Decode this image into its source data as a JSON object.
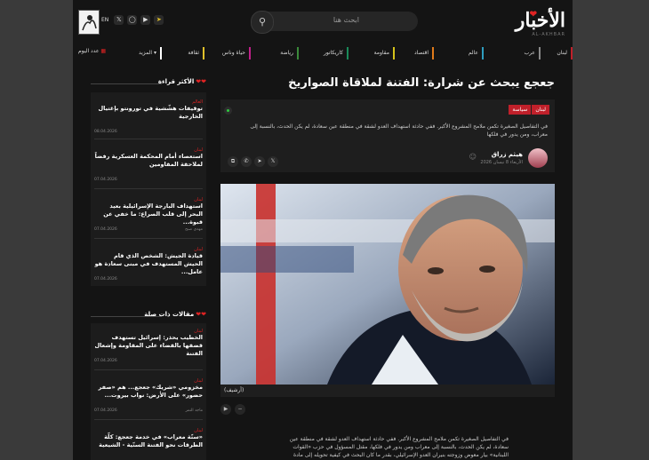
{
  "header": {
    "logo_text": "الأخبار",
    "logo_sub": "AL-AKHBAR",
    "search_placeholder": "ابحث هنا",
    "search_icon": "search-icon",
    "lang": "EN",
    "socials": [
      "x-icon",
      "youtube-icon",
      "instagram-icon",
      "telegram-icon"
    ]
  },
  "nav": {
    "items": [
      "لبنان",
      "عرب",
      "عالم",
      "اقتصاد",
      "مقاومة",
      "كاريكاتور",
      "رياضة",
      "حياة وناس",
      "ثقافة",
      "المزيد"
    ],
    "more_label": "المزيد",
    "today_label": "عدد اليوم",
    "colors": [
      "#c0202a",
      "#8a8a8a",
      "#2e9dbf",
      "#e07a1a",
      "#d4c21a",
      "#1a8a5a",
      "#3a8a3a",
      "#c0208a",
      "#e0c02a",
      "#ffffff"
    ]
  },
  "article": {
    "title": "جعجع يبحث عن شرارة: الفتنة لملاقاة الصواريخ",
    "tags": [
      "لبنان",
      "سياسة"
    ],
    "lead": "في التفاصيل الصغيرة تكمن ملامح المشروع الأكبر. ففي حادثة استهداف العدو لشقة في منطقة عين سعادة، لم يكن الحدث، بالنسبة إلى معراب، ومن يدور في فلكها",
    "author": "هيثم زراق",
    "date": "الأربعاء 8 نيسان 2026",
    "share_icons": [
      "x-icon",
      "telegram-icon",
      "whatsapp-icon",
      "copy-icon"
    ],
    "image_caption": "(أرشيف)",
    "body": "في التفاصيل الصغيرة تكمن ملامح المشروع الأكبر. ففي حادثة استهداف العدو لشقة في منطقة عين سعادة، لم يكن الحدث، بالنسبة إلى معراب ومن يدور في فلكها، مقتل المسؤول في حزب «القوات اللبنانية» بيار معوض وزوجته بنيران العدو الإسرائيلي، بقدر ما كان البحث في كيفية تحويله إلى مادة للتحريض"
  },
  "most_read": {
    "title": "الأكثر قراءة",
    "items": [
      {
        "tag": "العالم",
        "title": "توقيفات هشّشية في تورونتو بإغتيال الخارجية",
        "date": "08.04.2026",
        "author": ""
      },
      {
        "tag": "لبنان",
        "title": "استعصاء أمام المحكمة العسكرية رفضاً لملاحقة المقاومين",
        "date": "07.04.2026",
        "author": ""
      },
      {
        "tag": "لبنان",
        "title": "استهداف البارجة الإسرائيلية بعيد البحر إلى قلب الصراع: ما خفي عن قبوة...",
        "date": "07.04.2026",
        "author": "مهدي صبح"
      },
      {
        "tag": "لبنان",
        "title": "قيادة الجيش: الشخص الذي قام الحيش المستهدف في مبنى سعادة هو عامل...",
        "date": "07.04.2026",
        "author": ""
      }
    ]
  },
  "related": {
    "title": "مقالات ذات صلة",
    "items": [
      {
        "tag": "لبنان",
        "title": "الخطيب يحذر: إسرائيل تستهدف قضقها بالقضاء على المقاومة وإشعال الفتنة",
        "date": "07.04.2026",
        "author": ""
      },
      {
        "tag": "لبنان",
        "title": "مخزومي «شريك» جعجع... هم «صفر حضور» على الأرض: نواب بيروت...",
        "date": "07.04.2026",
        "author": "ماجد النمر"
      },
      {
        "tag": "لبنان",
        "title": "«سنّة معراب» في خدمة جعجع: كلّة الطرقات نحو الفتنة السنّية - الشيعية",
        "date": "",
        "author": ""
      }
    ]
  }
}
